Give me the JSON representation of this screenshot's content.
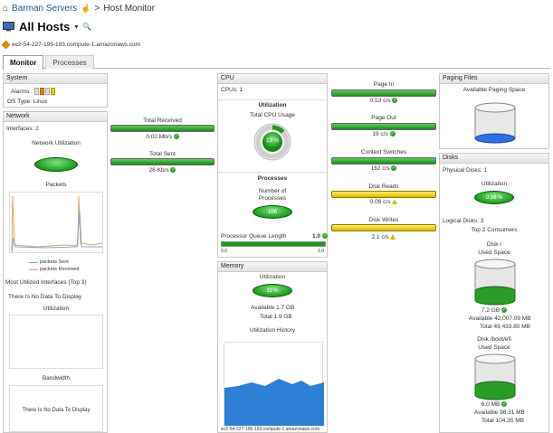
{
  "breadcrumb": {
    "root_link": "Barman Servers",
    "separator": ">",
    "current": "Host Monitor"
  },
  "title": {
    "text": "All Hosts",
    "caret": "▾"
  },
  "host": {
    "name": "ec2-54-227-195-193.compute-1.amazonaws.com"
  },
  "tabs": [
    {
      "label": "Monitor"
    },
    {
      "label": "Processes"
    }
  ],
  "system": {
    "header": "System",
    "alarms_label": "Alarms",
    "os_label": "OS Type:",
    "os_value": "Linux"
  },
  "network": {
    "header": "Network",
    "interfaces": "Interfaces: 2",
    "utilization_label": "Network Utilization",
    "packets_label": "Packets",
    "legend_sent": "packets Sent",
    "legend_received": "packets Received",
    "most_utilized": "Most Utilized Interfaces (Top 3)",
    "no_data": "There Is No Data To Display",
    "utilization_sub": "Utilization",
    "bandwidth_sub": "Bandwidth",
    "no_data_2": "There Is No Data To Display",
    "total_received_label": "Total Received",
    "total_received_value": "0.02 Mb/s",
    "total_sent_label": "Total Sent",
    "total_sent_value": "26 Kb/s"
  },
  "cpu": {
    "header": "CPU",
    "cpus": "CPUs:  1",
    "utilization_title": "Utilization",
    "total_cpu_usage": "Total CPU Usage",
    "usage_value": "13 %",
    "usage_fraction": 0.13,
    "processes_title": "Processes",
    "number_of_processes": "Number of Processes",
    "process_count": "106",
    "queue_label": "Processor Queue Length",
    "queue_value": "1.0",
    "queue_min": "0.0",
    "queue_max": "1.0"
  },
  "memory": {
    "header": "Memory",
    "utilization_title": "Utilization",
    "utilization_value": "11 %",
    "available": "Available  1.7 GB",
    "total": "Total  1.9 GB",
    "history_title": "Utilization History",
    "history_caption": "ec2-54-227-195-193.compute-1.amazonaws.com"
  },
  "paging_metrics": [
    {
      "label": "Page In",
      "value": "0.53 c/s",
      "status": "ok"
    },
    {
      "label": "Page Out",
      "value": "19 c/s",
      "status": "ok"
    },
    {
      "label": "Context Switches",
      "value": "162 c/s",
      "status": "ok"
    },
    {
      "label": "Disk Reads",
      "value": "0.06 c/s",
      "status": "warn"
    },
    {
      "label": "Disk Writes",
      "value": "2.1 c/s",
      "status": "warn"
    }
  ],
  "paging_files": {
    "header": "Paging Files",
    "available_label": "Available Paging Space"
  },
  "disks": {
    "header": "Disks",
    "physical": "Physical Disks:  1",
    "utilization_title": "Utilization",
    "utilization_value": "0.16 %",
    "logical": "Logical Disks:  3",
    "top2": "Top 2 Consumers",
    "disk1": {
      "name": "Disk /",
      "used_label": "Used Space",
      "used_value": "7.2 GB",
      "used_fraction": 0.15,
      "available": "Available  42,007.09 MB",
      "total": "Total  49,433.80 MB"
    },
    "disk2": {
      "name": "Disk /boot/efi",
      "used_label": "Used Space",
      "used_value": "6.0 MB",
      "used_fraction": 0.06,
      "available": "Available  98.31 MB",
      "total": "Total  104.35 MB"
    }
  },
  "colors": {
    "green": "#1b9a1b",
    "blue": "#2e7fd6",
    "yellow": "#e0b800",
    "link": "#1a5a96"
  }
}
